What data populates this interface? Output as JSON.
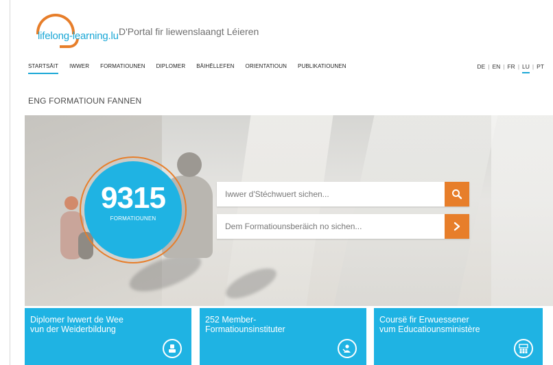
{
  "header": {
    "logo_text": "lifelong-learning.lu",
    "tagline": "D'Portal fir liewenslaangt Léieren"
  },
  "nav": {
    "items": [
      {
        "label": "STARTSÄIT",
        "active": true
      },
      {
        "label": "IWWER",
        "active": false
      },
      {
        "label": "FORMATIOUNEN",
        "active": false
      },
      {
        "label": "DIPLOMER",
        "active": false
      },
      {
        "label": "BÄIHËLLEFEN",
        "active": false
      },
      {
        "label": "ORIENTATIOUN",
        "active": false
      },
      {
        "label": "PUBLIKATIOUNEN",
        "active": false
      }
    ]
  },
  "languages": {
    "items": [
      "DE",
      "EN",
      "FR",
      "LU",
      "PT"
    ],
    "active": "LU"
  },
  "section_title": "ENG FORMATIOUN FANNEN",
  "hero": {
    "count": "9315",
    "count_label": "FORMATIOUNEN",
    "search_placeholder": "Iwwer d'Stéchwuert sichen...",
    "category_placeholder": "Dem Formatiounsberäich no sichen..."
  },
  "tiles": [
    {
      "lines": [
        "Diplomer Iwwert de Wee",
        "vun der Weiderbildung"
      ],
      "icon": "diploma-icon"
    },
    {
      "lines": [
        "252 Member-",
        "Formatiounsinstituter"
      ],
      "icon": "institution-icon"
    },
    {
      "lines": [
        "Coursë fir Erwuessener",
        "vum Educatiounsministère"
      ],
      "icon": "classroom-icon"
    }
  ],
  "colors": {
    "accent_blue": "#1fb3e3",
    "accent_orange": "#e77e2a"
  }
}
